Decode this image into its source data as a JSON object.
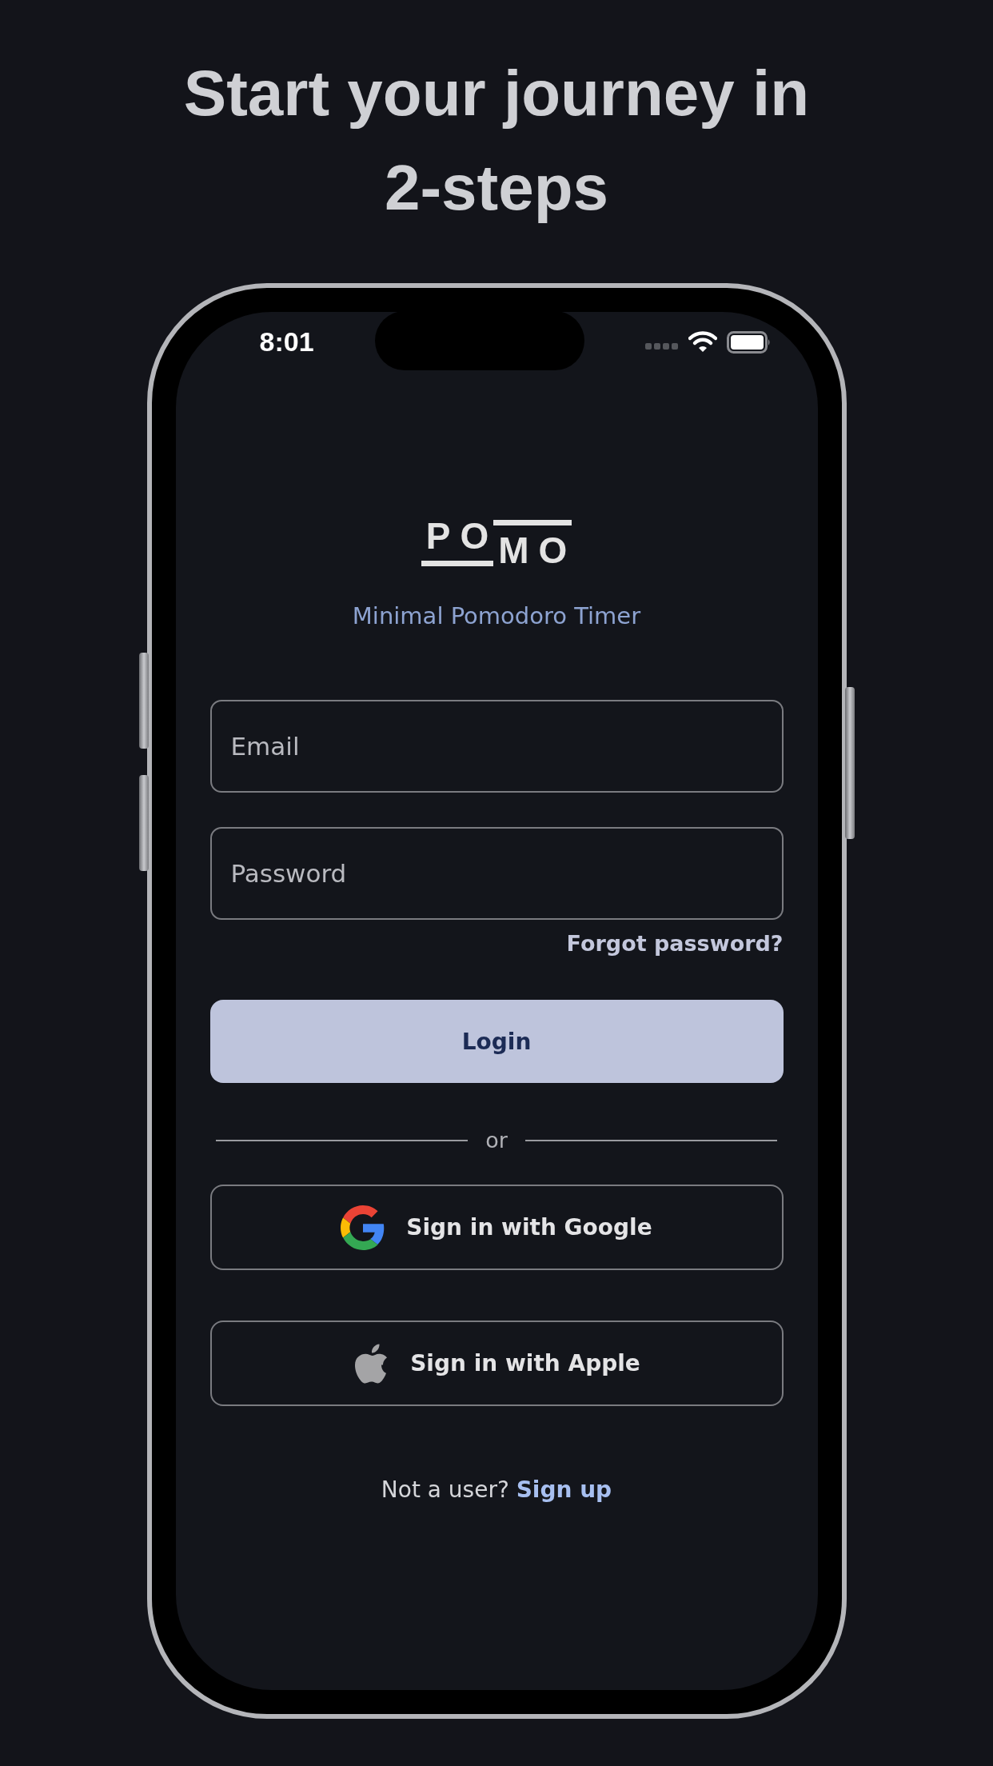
{
  "headline": "Start your journey in 2-steps",
  "status_bar": {
    "time": "8:01"
  },
  "logo": {
    "text": "POMO"
  },
  "tagline": "Minimal Pomodoro Timer",
  "fields": [
    {
      "placeholder": "Email"
    },
    {
      "placeholder": "Password"
    }
  ],
  "forgot_link": "Forgot password?",
  "login_button": "Login",
  "divider_text": "or",
  "social_buttons": [
    {
      "kind": "google",
      "label": "Sign in with Google"
    },
    {
      "kind": "apple",
      "label": "Sign in with Apple"
    }
  ],
  "signup": {
    "prompt": "Not a user?",
    "link": "Sign up"
  }
}
